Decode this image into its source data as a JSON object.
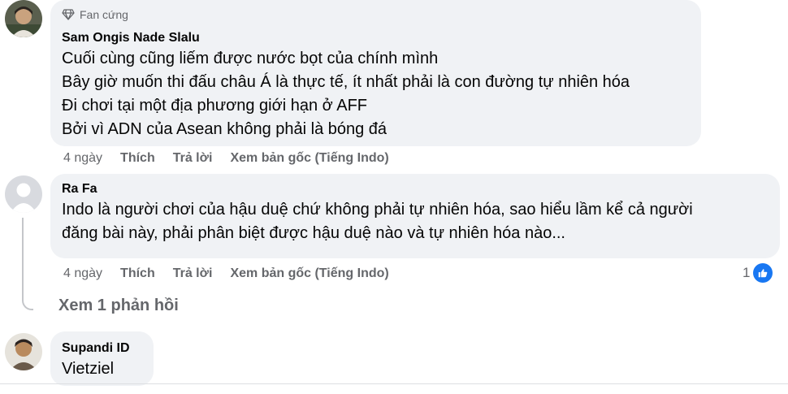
{
  "comments": [
    {
      "badge": "Fan cứng",
      "author": "Sam Ongis Nade Slalu",
      "lines": [
        "Cuối cùng cũng liếm được nước bọt của chính mình",
        "Bây giờ muốn thi đấu châu Á là thực tế, ít nhất phải là con đường tự nhiên hóa",
        "Đi chơi tại một địa phương giới hạn ở AFF",
        "Bởi vì ADN của Asean không phải là bóng đá"
      ],
      "time": "4 ngày",
      "like_label": "Thích",
      "reply_label": "Trả lời",
      "see_original_label": "Xem bản gốc (Tiếng Indo)"
    },
    {
      "author": "Ra Fa",
      "lines": [
        "Indo là người chơi của hậu duệ chứ không phải tự nhiên hóa, sao hiểu lầm kể cả người",
        "đăng bài này, phải phân biệt được hậu duệ nào và tự nhiên hóa nào..."
      ],
      "time": "4 ngày",
      "like_label": "Thích",
      "reply_label": "Trả lời",
      "see_original_label": "Xem bản gốc (Tiếng Indo)",
      "reaction_count": "1",
      "reaction_icon": "like-icon",
      "view_replies_label": "Xem 1 phản hồi"
    },
    {
      "author": "Supandi ID",
      "lines": [
        "Vietziel"
      ]
    }
  ],
  "colors": {
    "bubble": "#f0f2f5",
    "secondary_text": "#65676b",
    "like_blue": "#1877f2"
  }
}
